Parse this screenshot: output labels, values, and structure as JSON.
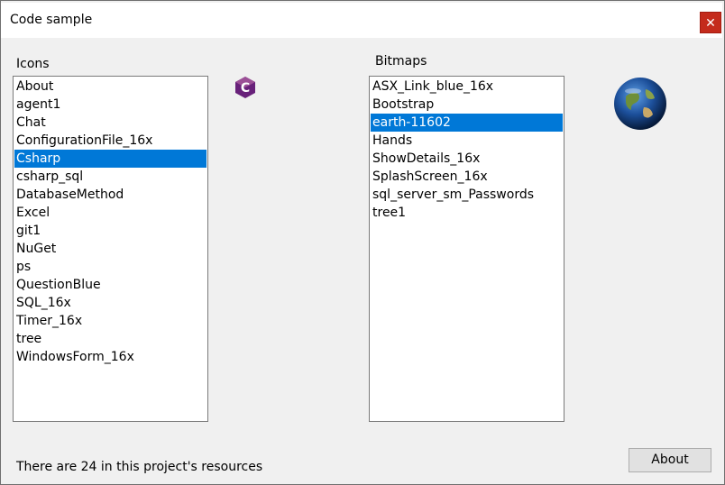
{
  "window": {
    "title": "Code sample",
    "close_glyph": "✕"
  },
  "icons_panel": {
    "label": "Icons",
    "items": [
      "About",
      "agent1",
      "Chat",
      "ConfigurationFile_16x",
      "Csharp",
      "csharp_sql",
      "DatabaseMethod",
      "Excel",
      "git1",
      "NuGet",
      "ps",
      "QuestionBlue",
      "SQL_16x",
      "Timer_16x",
      "tree",
      "WindowsForm_16x"
    ],
    "selected": "Csharp",
    "preview_icon": "csharp-icon"
  },
  "bitmaps_panel": {
    "label": "Bitmaps",
    "items": [
      "ASX_Link_blue_16x",
      "Bootstrap",
      "earth-11602",
      "Hands",
      "ShowDetails_16x",
      "SplashScreen_16x",
      "sql_server_sm_Passwords",
      "tree1"
    ],
    "selected": "earth-11602",
    "preview_icon": "earth-icon"
  },
  "status": {
    "text": "There are 24 in this project's resources"
  },
  "buttons": {
    "about_label": "About"
  },
  "colors": {
    "selection": "#0078d7",
    "close": "#c42b1c",
    "csharp": "#68217a"
  }
}
